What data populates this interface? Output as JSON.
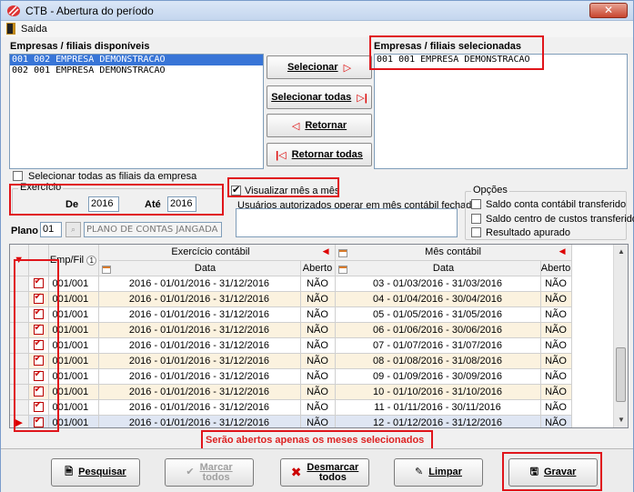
{
  "window": {
    "title": "CTB - Abertura do período",
    "menu": [
      "Saída"
    ]
  },
  "available": {
    "label": "Empresas / filiais disponíveis",
    "items": [
      "001 002 EMPRESA DEMONSTRACAO",
      "002 001 EMPRESA DEMONSTRACAO"
    ],
    "selected_index": 0
  },
  "selected": {
    "label": "Empresas / filiais selecionadas",
    "items": [
      "001 001 EMPRESA DEMONSTRACAO"
    ]
  },
  "transfer_buttons": {
    "select": "Selecionar",
    "select_all": "Selecionar todas",
    "return": "Retornar",
    "return_all": "Retornar todas"
  },
  "select_all_branches": {
    "label": "Selecionar todas as filiais da empresa",
    "checked": false
  },
  "exercicio": {
    "title": "Exercício",
    "de_label": "De",
    "de_value": "2016",
    "ate_label": "Até",
    "ate_value": "2016"
  },
  "visualizar": {
    "label": "Visualizar mês a mês",
    "checked": true
  },
  "usuarios": {
    "label": "Usuários autorizados operar em mês contábil fechado",
    "value": ""
  },
  "plano": {
    "label": "Plano",
    "code": "01",
    "description": "PLANO DE CONTAS JANGADA"
  },
  "opcoes": {
    "title": "Opções",
    "items": [
      {
        "label": "Saldo conta contábil transferido",
        "checked": false
      },
      {
        "label": "Saldo centro de custos transferido",
        "checked": false
      },
      {
        "label": "Resultado apurado",
        "checked": false
      }
    ]
  },
  "grid": {
    "header_emp": "Emp/Fil",
    "sort_badge": "1",
    "group_exercicio": "Exercício contábil",
    "group_mes": "Mês contábil",
    "col_data": "Data",
    "col_aberto": "Aberto",
    "rows": [
      {
        "emp": "001/001",
        "ex_data": "2016 - 01/01/2016 - 31/12/2016",
        "ex_aberto": "NÃO",
        "mes_data": "03 - 01/03/2016 - 31/03/2016",
        "mes_aberto": "NÃO"
      },
      {
        "emp": "001/001",
        "ex_data": "2016 - 01/01/2016 - 31/12/2016",
        "ex_aberto": "NÃO",
        "mes_data": "04 - 01/04/2016 - 30/04/2016",
        "mes_aberto": "NÃO"
      },
      {
        "emp": "001/001",
        "ex_data": "2016 - 01/01/2016 - 31/12/2016",
        "ex_aberto": "NÃO",
        "mes_data": "05 - 01/05/2016 - 31/05/2016",
        "mes_aberto": "NÃO"
      },
      {
        "emp": "001/001",
        "ex_data": "2016 - 01/01/2016 - 31/12/2016",
        "ex_aberto": "NÃO",
        "mes_data": "06 - 01/06/2016 - 30/06/2016",
        "mes_aberto": "NÃO"
      },
      {
        "emp": "001/001",
        "ex_data": "2016 - 01/01/2016 - 31/12/2016",
        "ex_aberto": "NÃO",
        "mes_data": "07 - 01/07/2016 - 31/07/2016",
        "mes_aberto": "NÃO"
      },
      {
        "emp": "001/001",
        "ex_data": "2016 - 01/01/2016 - 31/12/2016",
        "ex_aberto": "NÃO",
        "mes_data": "08 - 01/08/2016 - 31/08/2016",
        "mes_aberto": "NÃO"
      },
      {
        "emp": "001/001",
        "ex_data": "2016 - 01/01/2016 - 31/12/2016",
        "ex_aberto": "NÃO",
        "mes_data": "09 - 01/09/2016 - 30/09/2016",
        "mes_aberto": "NÃO"
      },
      {
        "emp": "001/001",
        "ex_data": "2016 - 01/01/2016 - 31/12/2016",
        "ex_aberto": "NÃO",
        "mes_data": "10 - 01/10/2016 - 31/10/2016",
        "mes_aberto": "NÃO"
      },
      {
        "emp": "001/001",
        "ex_data": "2016 - 01/01/2016 - 31/12/2016",
        "ex_aberto": "NÃO",
        "mes_data": "11 - 01/11/2016 - 30/11/2016",
        "mes_aberto": "NÃO"
      },
      {
        "emp": "001/001",
        "ex_data": "2016 - 01/01/2016 - 31/12/2016",
        "ex_aberto": "NÃO",
        "mes_data": "12 - 01/12/2016 - 31/12/2016",
        "mes_aberto": "NÃO"
      }
    ]
  },
  "footer_message": "Serão abertos apenas os meses selecionados",
  "bottom_buttons": {
    "pesquisar": "Pesquisar",
    "marcar_l1": "Marcar",
    "marcar_l2": "todos",
    "desmarcar_l1": "Desmarcar",
    "desmarcar_l2": "todos",
    "limpar": "Limpar",
    "gravar": "Gravar"
  },
  "colors": {
    "highlight_red": "#e0151b",
    "selection_blue": "#3875d7",
    "row_alt": "#fbf2df"
  }
}
